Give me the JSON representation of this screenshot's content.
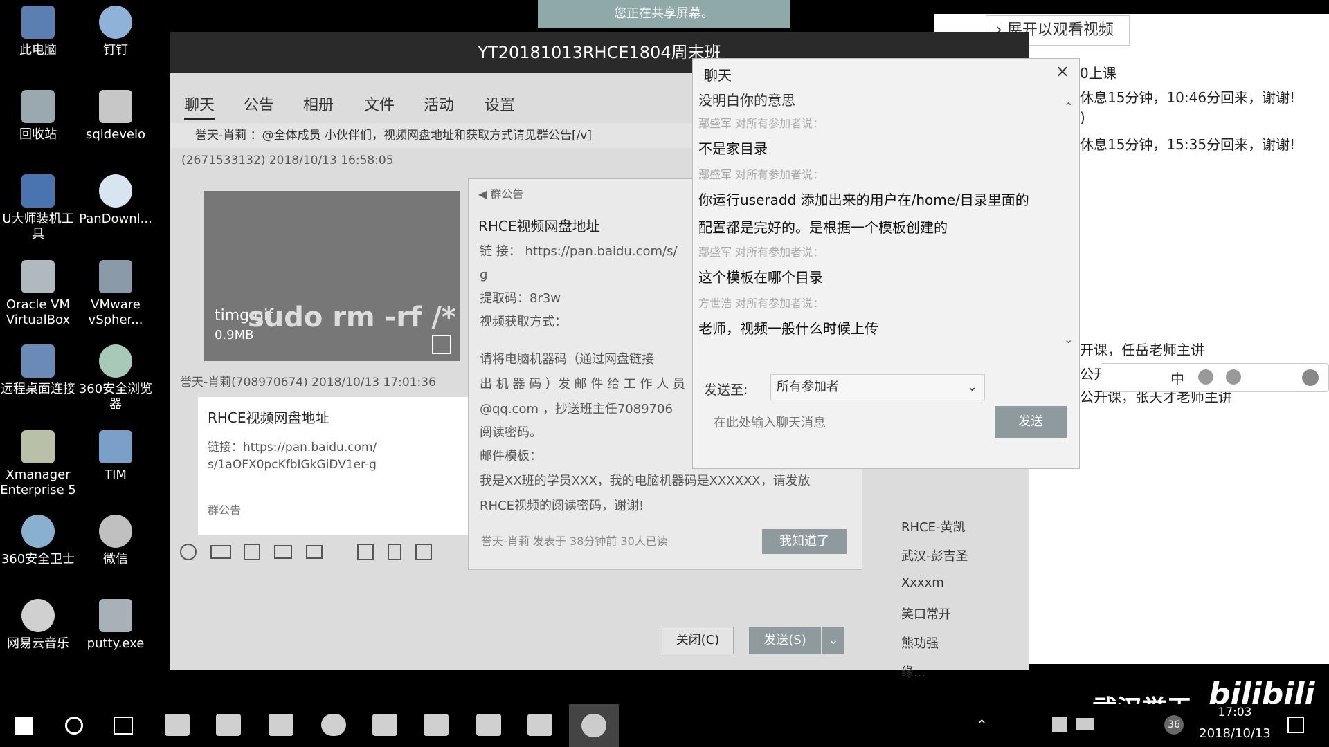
{
  "desktop": {
    "icons": [
      {
        "label": "此电脑",
        "icon": "computer-icon"
      },
      {
        "label": "钉钉",
        "icon": "dingtalk-icon"
      },
      {
        "label": "回收站",
        "icon": "recycle-bin-icon"
      },
      {
        "label": "sqldevelo",
        "icon": "sqldeveloper-icon"
      },
      {
        "label": "U大师装机工具",
        "icon": "tool-icon"
      },
      {
        "label": "PanDownl...",
        "icon": "pandownload-icon"
      },
      {
        "label": "Oracle VM VirtualBox",
        "icon": "virtualbox-icon"
      },
      {
        "label": "VMware vSpher...",
        "icon": "vmware-icon"
      },
      {
        "label": "远程桌面连接",
        "icon": "remote-desktop-icon"
      },
      {
        "label": "360安全浏览器",
        "icon": "browser-icon"
      },
      {
        "label": "Xmanager Enterprise 5",
        "icon": "xmanager-icon"
      },
      {
        "label": "TIM",
        "icon": "tim-icon"
      },
      {
        "label": "360安全卫士",
        "icon": "security-icon"
      },
      {
        "label": "微信",
        "icon": "wechat-icon"
      },
      {
        "label": "网易云音乐",
        "icon": "music-icon"
      },
      {
        "label": "putty.exe",
        "icon": "putty-icon"
      }
    ]
  },
  "share_banner": "您正在共享屏幕。",
  "expand_video": "展开以观看视频",
  "group_window": {
    "title": "YT20181013RHCE1804周末班",
    "tabs": [
      "聊天",
      "公告",
      "相册",
      "文件",
      "活动",
      "设置"
    ],
    "pinned_notice": "誉天-肖莉 ：@全体成员 小伙伴们，视频网盘地址和获取方式请见群公告[/v]",
    "msg1_header": "(2671533132) 2018/10/13 16:58:05",
    "image_name": "timg.gif",
    "image_size": "0.9MB",
    "image_caption": "sudo rm -rf /*",
    "msg2_header": "誉天-肖莉(708970674) 2018/10/13 17:01:36",
    "card": {
      "title": "RHCE视频网盘地址",
      "line1": "链接：https://pan.baidu.com/",
      "line2": "s/1aOFX0pcKfbIGkGiDV1er-g",
      "footer": "群公告"
    },
    "close_button": "关闭(C)",
    "send_button": "发送(S)"
  },
  "announcement": {
    "header": "群公告",
    "title": "RHCE视频网盘地址",
    "lines": [
      "链 接： https://pan.baidu.com/s/",
      "g",
      "提取码：8r3w",
      "视频获取方式：",
      "请将电脑机器码（通过网盘链接",
      "出 机 器 码 ）发 邮 件 给 工 作 人 员",
      "@qq.com ，抄送班主任7089706",
      "阅读密码。",
      "邮件模板：",
      "我是XX班的学员XXX，我的电脑机器码是XXXXXX，请发放",
      "RHCE视频的阅读密码，谢谢!"
    ],
    "meta": "誉天-肖莉  发表于 38分钟前  30人已读",
    "ok_button": "我知道了"
  },
  "chat_panel": {
    "title": "聊天",
    "messages": [
      {
        "from": "",
        "text": "没明白你的意思"
      },
      {
        "from": "鄢盛军 对所有参加者说：",
        "text": "不是家目录"
      },
      {
        "from": "鄢盛军 对所有参加者说：",
        "text": "你运行useradd 添加出来的用户在/home/目录里面的"
      },
      {
        "from": "",
        "text": "配置都是完好的。是根据一个模板创建的"
      },
      {
        "from": "鄢盛军 对所有参加者说：",
        "text": "这个模板在哪个目录"
      },
      {
        "from": "方世浩 对所有参加者说：",
        "text": "老师，视频一般什么时候上传"
      }
    ],
    "send_to_label": "发送至:",
    "send_to_value": "所有参加者",
    "input_placeholder": "在此处输入聊天消息",
    "send_button": "发送"
  },
  "right_notes": [
    "0上课",
    "休息15分钟，10:46分回来，谢谢!",
    ")",
    "休息15分钟，15:35分回来，谢谢!",
    "开课，任岳老师主讲",
    "公开课，",
    "公开课，张天才老师主讲"
  ],
  "member_list": [
    "RHCE-黄凯",
    "武汉-彭吉圣",
    "Xxxxm",
    "笑口常开",
    "熊功强",
    "缘..."
  ],
  "watermark": {
    "brand": "武汉誉天",
    "site": "bilibili"
  },
  "taskbar": {
    "date": "2018/10/13",
    "time": "17:03",
    "badge": "36",
    "ime_label": "中"
  }
}
